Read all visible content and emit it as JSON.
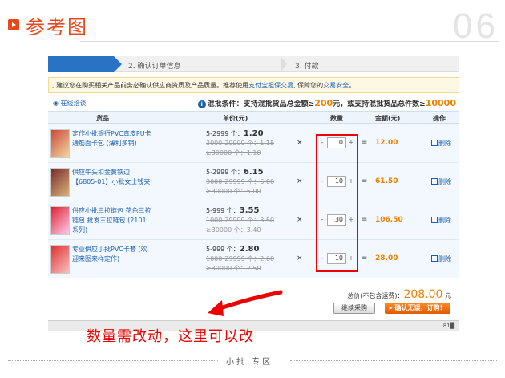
{
  "header": {
    "title": "参考图",
    "number": "06"
  },
  "steps": {
    "step2": "2. 确认订单信息",
    "step3": "3. 付款"
  },
  "notice": {
    "text_before": ", 建议您在购买相关产品前务必确认供应商资质及产品质量。推荐使用",
    "link1": "支付宝担保交易",
    "text_after": ", 保障您的",
    "link2": "交易安全",
    "end": "。"
  },
  "bar": {
    "chat": "在线洽谈",
    "rule_prefix": "混批条件：支持混批货品总金额≥",
    "amount": "200",
    "rule_mid": "元，或支持混批货品总件数≥",
    "count": "10000"
  },
  "table": {
    "headers": [
      "货品",
      "单价(元)",
      "数量",
      "金额(元)",
      "操作"
    ]
  },
  "items": [
    {
      "name": "定作小批银行PVC真皮PU卡通筋面卡包 (薄利多销)",
      "price_range": "5-2999 个：",
      "price": "1.20",
      "old1": "3000-29999 个：1.15",
      "old2": "≥30000 个：1.10",
      "qty": "10",
      "amount": "12.00",
      "delete": "删除"
    },
    {
      "name": "供应牛头扣金黄铁边【6805-01】小批女士钱夹",
      "price_range": "5-2999 个：",
      "price": "6.15",
      "old1": "3000-29999 个：6.00",
      "old2": "≥30000 个：5.00",
      "qty": "10",
      "amount": "61.50",
      "delete": "删除"
    },
    {
      "name": "供应小批三拉链包 花色三拉链包 批发三拉链包 (2101系列)",
      "price_range": "5-999 个：",
      "price": "3.55",
      "old1": "1000-29999 个：3.50",
      "old2": "≥30000 个：3.40",
      "qty": "30",
      "amount": "106.50",
      "delete": "删除"
    },
    {
      "name": "专业供应小批PVC卡套 (欢迎来图来样定作)",
      "price_range": "5-999 个：",
      "price": "2.80",
      "old1": "1000-29999 个：2.60",
      "old2": "≥30000 个：2.50",
      "qty": "10",
      "amount": "28.00",
      "delete": "删除"
    }
  ],
  "summary": {
    "label": "总价(不包含运费)：",
    "total": "208.00",
    "unit": "元"
  },
  "buttons": {
    "continue": "继续采购",
    "confirm": "确认无误，订购！"
  },
  "status": {
    "text": "81█"
  },
  "annotation": "数量需改动，这里可以改",
  "footer": {
    "text": "小批 专区"
  },
  "colors": {
    "accent": "#e8481b",
    "blue": "#2a73c4",
    "orange": "#f08000",
    "red": "#ee0000"
  }
}
